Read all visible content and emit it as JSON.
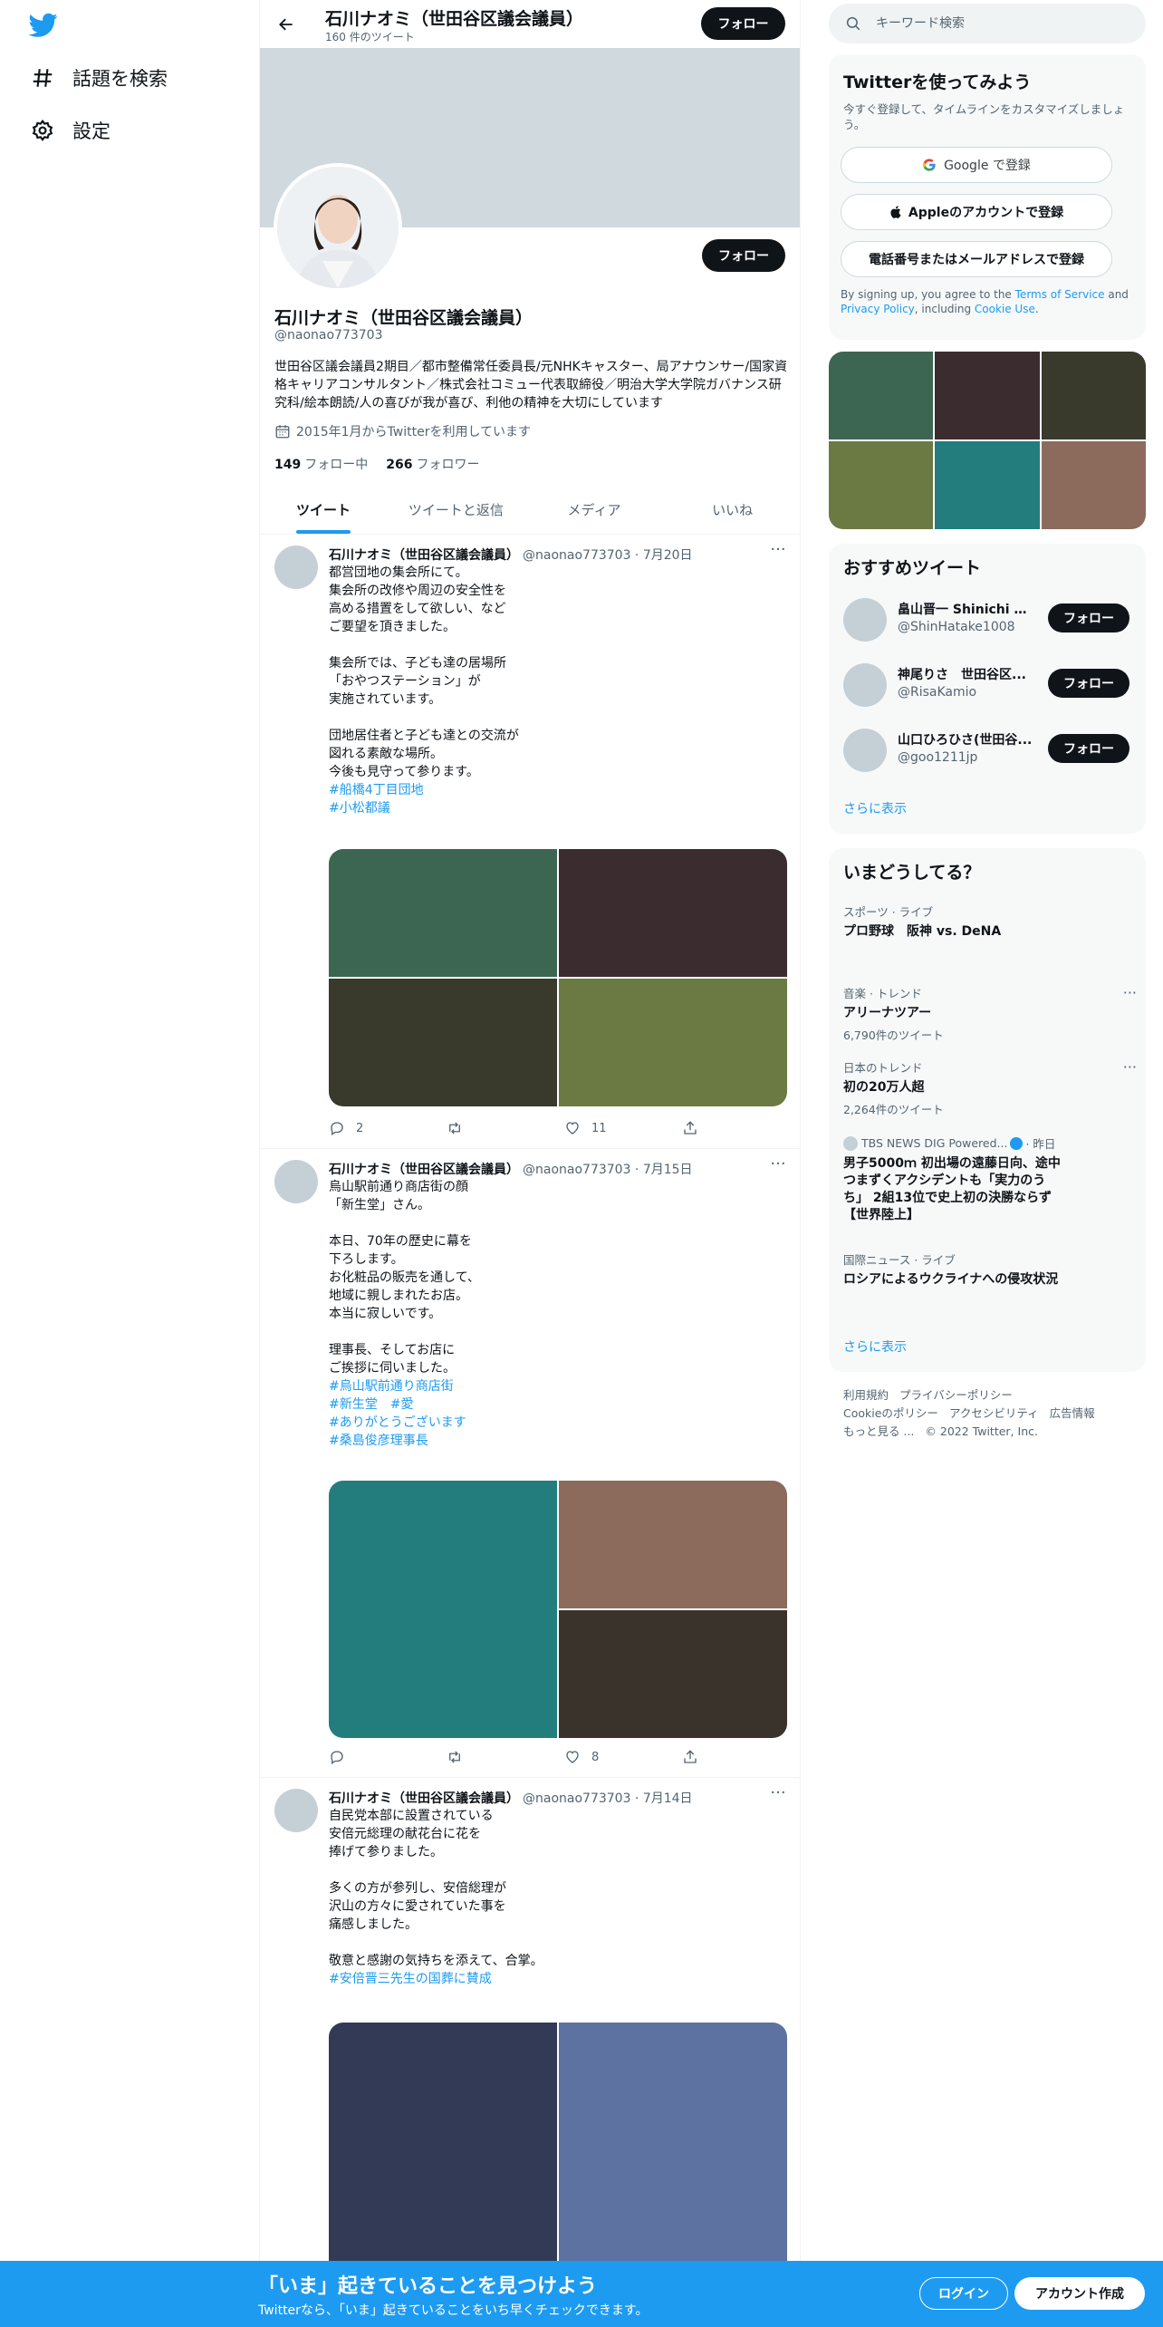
{
  "nav": {
    "logo_icon": "twitter-bird-icon",
    "explore_label": "話題を検索",
    "settings_label": "設定"
  },
  "header": {
    "name": "石川ナオミ（世田谷区議会議員）",
    "tweet_count": "160 件のツイート",
    "follow_label": "フォロー"
  },
  "profile": {
    "name": "石川ナオミ（世田谷区議会議員）",
    "handle": "@naonao773703",
    "bio": "世田谷区議会議員2期目／都市整備常任委員長/元NHKキャスター、局アナウンサー/国家資格キャリアコンサルタント／株式会社コミュー代表取締役／明治大学大学院ガバナンス研究科/絵本朗読/人の喜びが我が喜び、利他の精神を大切にしています",
    "joined": "2015年1月からTwitterを利用しています",
    "following_count": "149",
    "following_label": "フォロー中",
    "followers_count": "266",
    "followers_label": "フォロワー",
    "follow_label": "フォロー"
  },
  "tabs": [
    "ツイート",
    "ツイートと返信",
    "メディア",
    "いいね"
  ],
  "tweets": [
    {
      "name": "石川ナオミ（世田谷区議会議員）",
      "meta": "@naonao773703 · 7月20日",
      "text": "都営団地の集会所にて。\n集会所の改修や周辺の安全性を\n高める措置をして欲しい、など\nご要望を頂きました。\n\n集会所では、子ども達の居場所\n「おやつステーション」が\n実施されています。\n\n団地居住者と子ども達との交流が\n図れる素敵な場所。\n今後も見守って参ります。\n",
      "tags": [
        "#船橋4丁目団地",
        "#小松都議"
      ],
      "media_colors": [
        "#3d6652",
        "#3b2c30",
        "#39392c",
        "#6b7a43"
      ],
      "reply_count": "2",
      "retweet_count": "",
      "like_count": "11"
    },
    {
      "name": "石川ナオミ（世田谷区議会議員）",
      "meta": "@naonao773703 · 7月15日",
      "text": "烏山駅前通り商店街の顔\n「新生堂」さん。\n\n本日、70年の歴史に幕を\n下ろします。\nお化粧品の販売を通して、\n地域に親しまれたお店。\n本当に寂しいです。\n\n理事長、そしてお店に\nご挨拶に伺いました。\n",
      "tags": [
        "#烏山駅前通り商店街",
        "#新生堂　#愛",
        "#ありがとうございます",
        "#桑島俊彦理事長"
      ],
      "media_colors": [
        "#237d7d",
        "#8c6b5c",
        "#3a332c"
      ],
      "reply_count": "",
      "retweet_count": "",
      "like_count": "8"
    },
    {
      "name": "石川ナオミ（世田谷区議会議員）",
      "meta": "@naonao773703 · 7月14日",
      "text": "自民党本部に設置されている\n安倍元総理の献花台に花を\n捧げて参りました。\n\n多くの方が参列し、安倍総理が\n沢山の方々に愛されていた事を\n痛感しました。\n\n敬意と感謝の気持ちを添えて、合掌。\n",
      "tags": [
        "#安倍晋三先生の国葬に賛成"
      ],
      "media_colors": [
        "#333a55",
        "#5d72a0"
      ]
    }
  ],
  "right": {
    "search_placeholder": "キーワード検索",
    "signup": {
      "title": "Twitterを使ってみよう",
      "subtitle": "今すぐ登録して、タイムラインをカスタマイズしましょう。",
      "google_label": "Google で登録",
      "apple_label": "Appleのアカウントで登録",
      "phone_label": "電話番号またはメールアドレスで登録",
      "terms_prefix": "By signing up, you agree to the ",
      "terms_link": "Terms of Service",
      "terms_and": " and ",
      "privacy_link": "Privacy Policy",
      "terms_including": ", including ",
      "cookie_link": "Cookie Use",
      "terms_end": "."
    },
    "photo_colors": [
      "#3d6652",
      "#3b2c30",
      "#39392c",
      "#6b7a43",
      "#237d7d",
      "#8c6b5c"
    ],
    "recommend": {
      "title": "おすすめツイート",
      "users": [
        {
          "name": "畠山晋一 Shinichi Ha...",
          "handle": "@ShinHatake1008"
        },
        {
          "name": "神尾りさ　世田谷区...",
          "handle": "@RisaKamio"
        },
        {
          "name": "山口ひろひさ(世田谷...",
          "handle": "@goo1211jp"
        }
      ],
      "follow_label": "フォロー",
      "show_more": "さらに表示"
    },
    "trends": {
      "title": "いまどうしてる？",
      "items": [
        {
          "context": "スポーツ · ライブ",
          "title": "プロ野球　阪神 vs. DeNA",
          "count": ""
        },
        {
          "context": "音楽 · トレンド",
          "title": "アリーナツアー",
          "count": "6,790件のツイート"
        },
        {
          "context": "日本のトレンド",
          "title": "初の20万人超",
          "count": "2,264件のツイート"
        }
      ],
      "news": {
        "source": "TBS NEWS DIG Powered...",
        "time": "· 昨日",
        "title": "男子5000ｍ 初出場の遠藤日向、途中つまずくアクシデントも「実力のうち」 2組13位で史上初の決勝ならず【世界陸上】"
      },
      "live": {
        "context": "国際ニュース · ライブ",
        "title": "ロシアによるウクライナへの侵攻状況"
      },
      "show_more": "さらに表示"
    },
    "footer": {
      "terms": "利用規約",
      "privacy": "プライバシーポリシー",
      "cookie": "Cookieのポリシー",
      "accessibility": "アクセシビリティ",
      "ads": "広告情報",
      "more": "もっと見る ...",
      "copyright": "© 2022 Twitter, Inc."
    }
  },
  "bottom_bar": {
    "title": "「いま」起きていることを見つけよう",
    "subtitle": "Twitterなら、「いま」起きていることをいち早くチェックできます。",
    "login_label": "ログイン",
    "signup_label": "アカウント作成"
  }
}
